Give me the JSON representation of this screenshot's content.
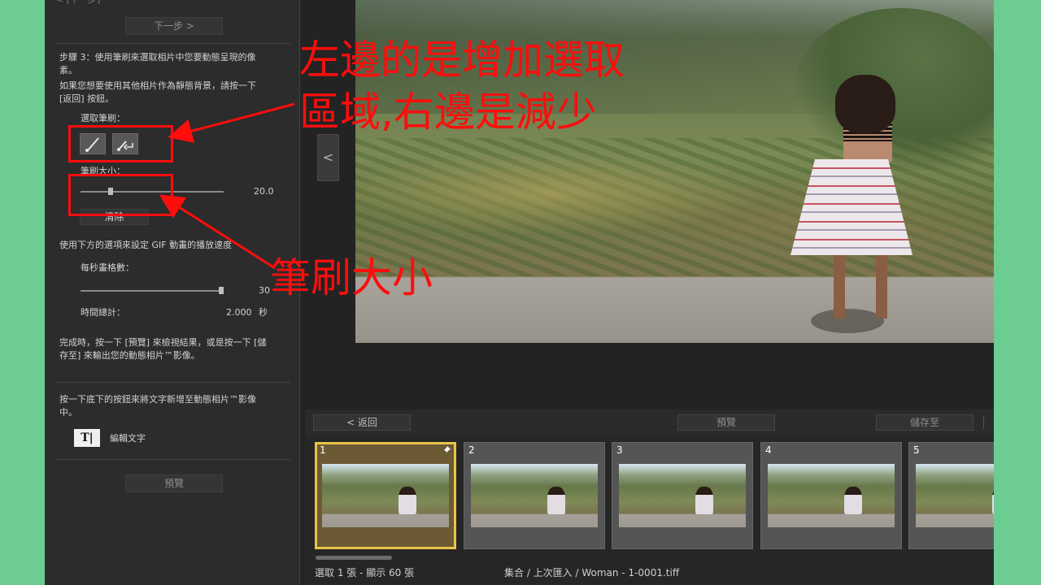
{
  "left_panel": {
    "top_crumb": "< [下一步]",
    "next_button": "下一步  >",
    "step3_text_1": "步驟 3：使用筆刷來選取相片中您要動態呈現的像",
    "step3_text_2": "素。",
    "bg_hint_1": "如果您想要使用其他相片作為靜態背景，請按一下",
    "bg_hint_2": "[返回] 按鈕。",
    "brush_label": "選取筆刷：",
    "brush_size_label": "筆刷大小：",
    "brush_size_value": "20.0",
    "clear_button": "清除",
    "gif_hint": "使用下方的選項來設定 GIF 動畫的播放速度",
    "fps_label": "每秒畫格數：",
    "fps_value": "30",
    "total_time_label": "時間總計：",
    "total_time_value": "2.000",
    "total_time_unit": "秒",
    "finish_hint_1": "完成時，按一下 [預覽] 來檢視結果，或是按一下 [儲",
    "finish_hint_2": "存至] 來輸出您的動態相片™影像。",
    "text_hint_1": "按一下底下的按鈕來將文字新增至動態相片™影像",
    "text_hint_2": "中。",
    "edit_text_icon_glyph": "T|",
    "edit_text_label": "編輯文字",
    "preview_button": "預覽"
  },
  "preview_nav": {
    "back_glyph": "<"
  },
  "toolbar": {
    "back_button": "<  返回",
    "preview_button": "預覽",
    "save_button": "儲存至"
  },
  "filmstrip": {
    "thumbs": [
      {
        "num": "1",
        "selected": true
      },
      {
        "num": "2",
        "selected": false
      },
      {
        "num": "3",
        "selected": false
      },
      {
        "num": "4",
        "selected": false
      },
      {
        "num": "5",
        "selected": false
      }
    ],
    "status_count": "選取 1 張 - 顯示 60 張",
    "status_path": "集合 / 上次匯入 / Woman - 1-0001.tiff"
  },
  "annotations": {
    "text_top_line1": "左邊的是增加選取",
    "text_top_line2": "區域,右邊是減少",
    "text_bottom": "筆刷大小",
    "color": "#ff0d0d"
  },
  "sliders": {
    "brush_size_fraction": 0.2,
    "fps_fraction": 1.0
  }
}
